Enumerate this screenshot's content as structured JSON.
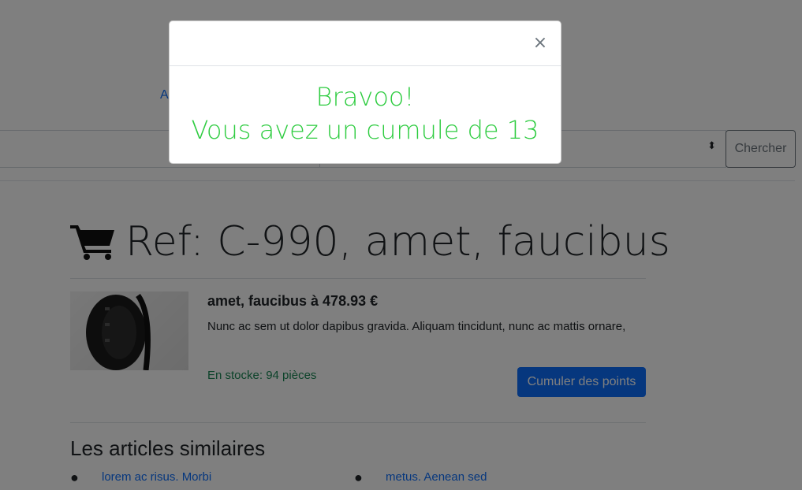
{
  "nav": {
    "partial_link": "A"
  },
  "search": {
    "button_label": "Chercher",
    "caret": "⬍"
  },
  "product": {
    "title": "Ref: C-990, amet, faucibus",
    "name_price": "amet, faucibus à 478.93 €",
    "description": "Nunc ac sem ut dolor dapibus gravida. Aliquam tincidunt, nunc ac mattis ornare,",
    "stock": "En stocke: 94 pièces",
    "points_button": "Cumuler des points",
    "image_icon": "headphones-image"
  },
  "similar": {
    "title": "Les articles similaires",
    "items": [
      {
        "label": "lorem ac risus. Morbi"
      },
      {
        "label": "metus. Aenean sed"
      }
    ]
  },
  "modal": {
    "close_label": "×",
    "line1": "Bravoo!",
    "line2": "Vous avez un cumule de 13"
  },
  "colors": {
    "accent": "#0d6efd",
    "success_text": "#198754",
    "modal_text": "#2ecc40"
  }
}
